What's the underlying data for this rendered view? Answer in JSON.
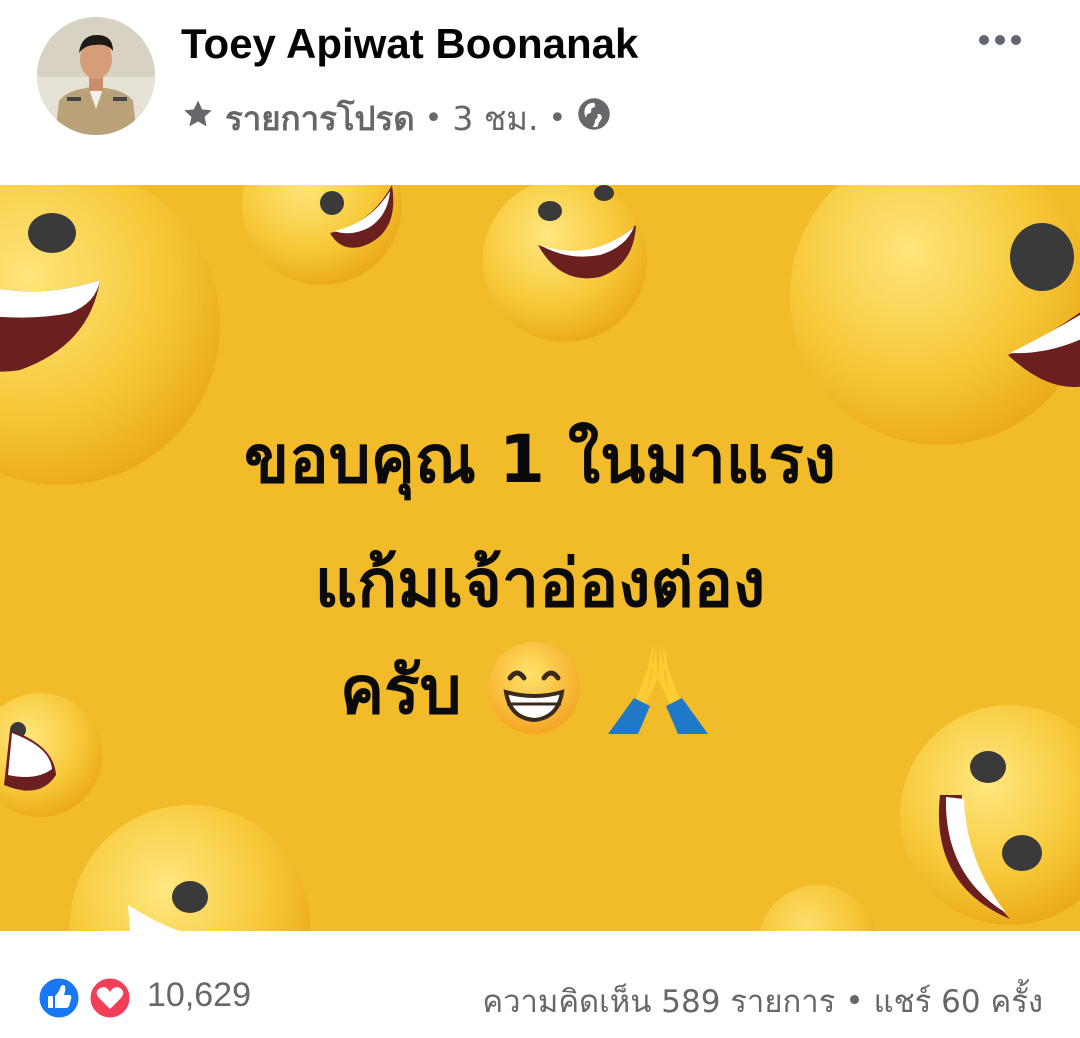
{
  "post": {
    "author": "Toey Apiwat Boonanak",
    "audience_label": "รายการโปรด",
    "timestamp": "3 ชม.",
    "separator": "•",
    "privacy_icon": "globe-icon",
    "favorite_icon": "star-icon",
    "more_icon": "more-horizontal-icon"
  },
  "image": {
    "line1": "ขอบคุณ 1 ในมาแรง",
    "line2": "แก้มเจ้าอ่องต่อง",
    "line3": "ครับ",
    "emoji": [
      "grinning-face-emoji",
      "folded-hands-emoji"
    ],
    "background_color": "#f2bb2a"
  },
  "reactions": {
    "icons": [
      "like-icon",
      "love-icon"
    ],
    "count": "10,629",
    "comments": "ความคิดเห็น 589 รายการ",
    "separator": "•",
    "shares": "แชร์ 60 ครั้ง"
  },
  "colors": {
    "like_blue": "#1877f2",
    "love_red": "#f33e58",
    "secondary_text": "#65676b"
  }
}
